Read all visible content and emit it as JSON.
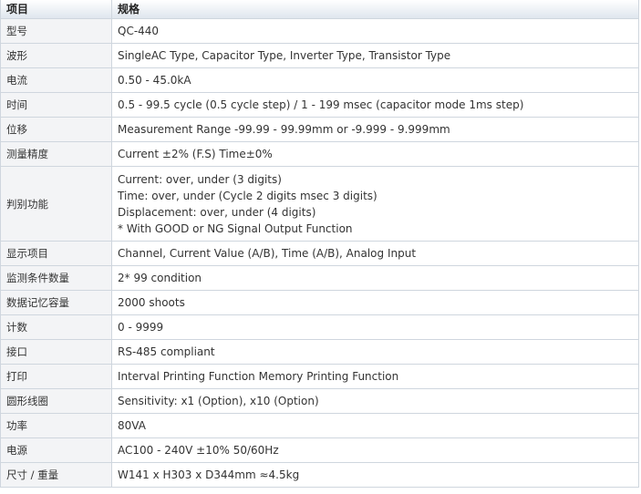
{
  "header": {
    "item": "项目",
    "spec": "规格"
  },
  "rows": [
    {
      "item": "型号",
      "value": "QC-440"
    },
    {
      "item": "波形",
      "value": "SingleAC Type, Capacitor Type, Inverter Type, Transistor Type"
    },
    {
      "item": "电流",
      "value": "0.50 - 45.0kA"
    },
    {
      "item": "时间",
      "value": "0.5 - 99.5 cycle (0.5 cycle step) / 1 - 199 msec (capacitor mode 1ms step)"
    },
    {
      "item": "位移",
      "value": "Measurement Range -99.99 - 99.99mm or -9.999 - 9.999mm"
    },
    {
      "item": "测量精度",
      "value": "Current ±2% (F.S) Time±0%"
    },
    {
      "item": "判别功能",
      "lines": [
        "Current: over, under (3 digits)",
        "Time: over, under (Cycle 2 digits    msec 3 digits)",
        "Displacement: over, under (4 digits)",
        "* With GOOD or NG Signal Output    Function"
      ]
    },
    {
      "item": "显示项目",
      "value": "Channel, Current Value (A/B), Time (A/B), Analog Input"
    },
    {
      "item": "监测条件数量",
      "value": "2* 99 condition"
    },
    {
      "item": "数据记忆容量",
      "value": "2000 shoots"
    },
    {
      "item": "计数",
      "value": "0 - 9999"
    },
    {
      "item": "接口",
      "value": "RS-485 compliant"
    },
    {
      "item": "打印",
      "value": "Interval Printing Function Memory Printing Function"
    },
    {
      "item": "圆形线圈",
      "value": "Sensitivity: x1 (Option), x10 (Option)"
    },
    {
      "item": "功率",
      "value": "80VA"
    },
    {
      "item": "电源",
      "value": "AC100 - 240V ±10% 50/60Hz"
    },
    {
      "item": "尺寸 / 重量",
      "value": "W141 x H303 x D344mm ≈4.5kg"
    }
  ]
}
